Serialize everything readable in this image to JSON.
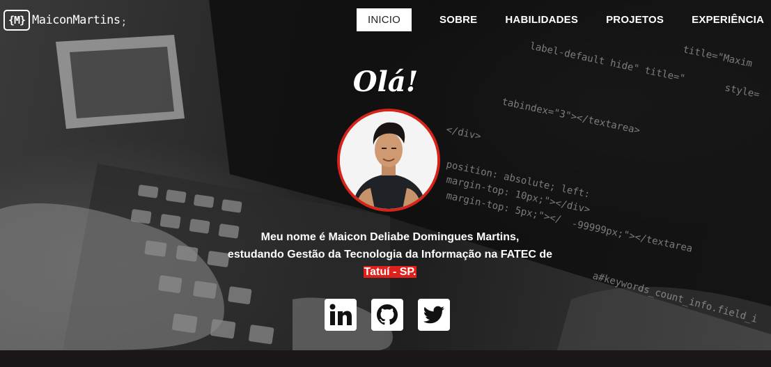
{
  "brand": {
    "logo_mark": "{M}",
    "name": "MaiconMartins",
    "suffix": ";"
  },
  "nav": {
    "items": [
      {
        "label": "INICIO",
        "active": true
      },
      {
        "label": "SOBRE"
      },
      {
        "label": "HABILIDADES"
      },
      {
        "label": "PROJETOS"
      },
      {
        "label": "EXPERIÊNCIA"
      }
    ]
  },
  "hero": {
    "greeting": "Olá!",
    "bio_line1": "Meu nome é Maicon Deliabe Domingues Martins,",
    "bio_line2": "estudando Gestão da Tecnologia da Informação na FATEC de",
    "bio_highlight": "Tatuí - SP."
  },
  "social": [
    {
      "name": "linkedin-icon"
    },
    {
      "name": "github-icon"
    },
    {
      "name": "twitter-icon"
    }
  ],
  "colors": {
    "accent": "#e0201a",
    "avatar_border": "#d7241b"
  },
  "background_code_snippets": [
    "title=\"Maxim",
    "label-default hide\" title=\"",
    "style=",
    "tabindex=\"3\"></textarea>",
    "position: absolute; left:",
    "margin-top: 10px;\"></div>",
    "margin-top: 5px;\"></",
    "</div>",
    "-99999px;\"></textarea",
    "a#keywords_count_info.field_i"
  ]
}
